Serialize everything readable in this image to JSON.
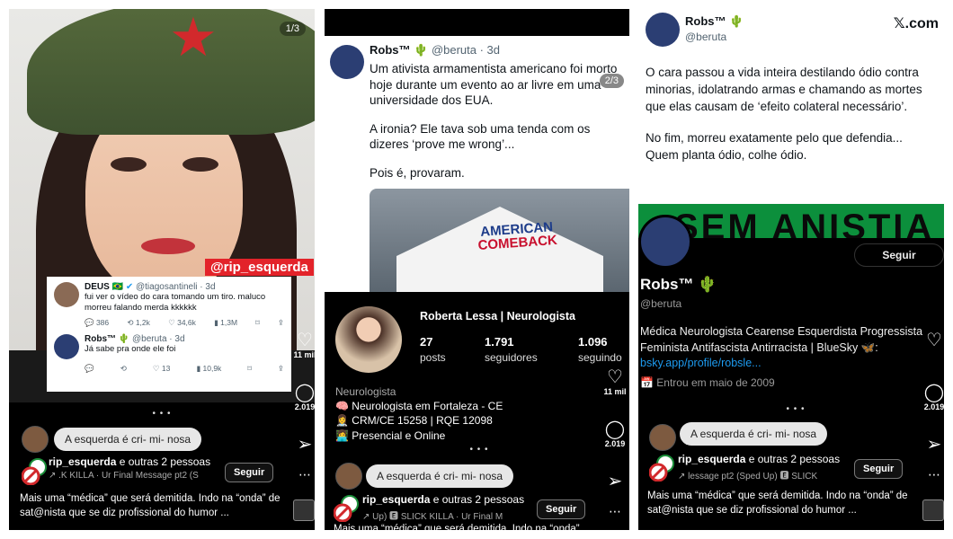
{
  "panel1": {
    "pager": "1/3",
    "watermark": "@rip_esquerda",
    "tweet1": {
      "name": "DEUS",
      "flag": "🇧🇷",
      "handle": "@tiagosantineli · 3d",
      "text": "fui ver o vídeo do cara tomando um tiro. maluco morreu falando merda kkkkkk",
      "replies": "386",
      "retweets": "1,2k",
      "likes": "34,6k",
      "views": "1,3M"
    },
    "tweet2": {
      "name": "Robs™",
      "handle": "@beruta · 3d",
      "text": "Já sabe pra onde ele foi",
      "likes": "13",
      "views": "10,9k"
    },
    "rail": {
      "likes": "11 mil",
      "comments": "2.019"
    },
    "dots": "• • •",
    "bubble": "A esquerda é cri- mi- nosa",
    "user": "rip_esquerda",
    "user_suffix": " e outras 2 pessoas",
    "music": "↗ .K KILLA · Ur Final Message pt2 (S",
    "follow": "Seguir",
    "caption": "Mais uma “médica” que será demitida. Indo na “onda” de sat@nista que se diz profissional do humor ..."
  },
  "panel2": {
    "name": "Robs™",
    "handle": "@beruta · 3d",
    "pager": "2/3",
    "p1": "Um ativista armamentista americano foi morto hoje durante um evento ao ar livre em uma universidade dos EUA.",
    "p2": "A ironia? Ele tava sob uma tenda com os dizeres ‘prove me wrong’...",
    "p3": "Pois é, provaram.",
    "tent_label_1": "AMERICAN",
    "tent_label_2": "COMEBACK",
    "ig": {
      "name": "Roberta Lessa | Neurologista",
      "posts": "27",
      "posts_label": "posts",
      "followers": "1.791",
      "followers_label": "seguidores",
      "following": "1.096",
      "following_label": "seguindo",
      "category": "Neurologista",
      "bio1": "🧠 Neurologista em Fortaleza - CE",
      "bio2": "👩‍⚕️ CRM/CE 15258 | RQE 12098",
      "bio3": "👩‍💻 Presencial e Online"
    },
    "rail": {
      "likes": "11 mil",
      "comments": "2.019"
    },
    "dots": "• • •",
    "bubble": "A esquerda é cri- mi- nosa",
    "user": "rip_esquerda",
    "user_suffix": " e outras 2 pessoas",
    "music": "↗ Up) 🅴 SLICK KILLA · Ur Final M",
    "follow": "Seguir",
    "caption": "Mais uma “médica” que será demitida. Indo na “onda”"
  },
  "panel3": {
    "name": "Robs™",
    "handle": "@beruta",
    "site": "𝕏.com",
    "p1": "O cara passou a vida inteira destilando ódio contra minorias, idolatrando armas e chamando as mortes que elas causam de ‘efeito colateral necessário’.",
    "p2": "No fim, morreu exatamente pelo que defendia... Quem planta ódio, colhe ódio.",
    "banner": "SEM ANISTIA",
    "follow_x": "Seguir",
    "profile_name": "Robs™",
    "profile_handle": "@beruta",
    "bio_line1": "Médica Neurologista Cearense Esquerdista Progressista",
    "bio_line2": "Feminista Antifascista Antirracista | BlueSky 🦋:",
    "bio_link": "bsky.app/profile/robsle...",
    "joined": "📅 Entrou em maio de 2009",
    "rail": {
      "likes": "11 mil",
      "comments": "2.019"
    },
    "dots": "• • •",
    "bubble": "A esquerda é cri- mi- nosa",
    "user": "rip_esquerda",
    "user_suffix": " e outras 2 pessoas",
    "music": "↗ lessage pt2 (Sped Up) 🅴  SLICK",
    "follow": "Seguir",
    "caption": "Mais uma “médica” que será demitida. Indo na “onda” de sat@nista que se diz profissional do humor ..."
  }
}
